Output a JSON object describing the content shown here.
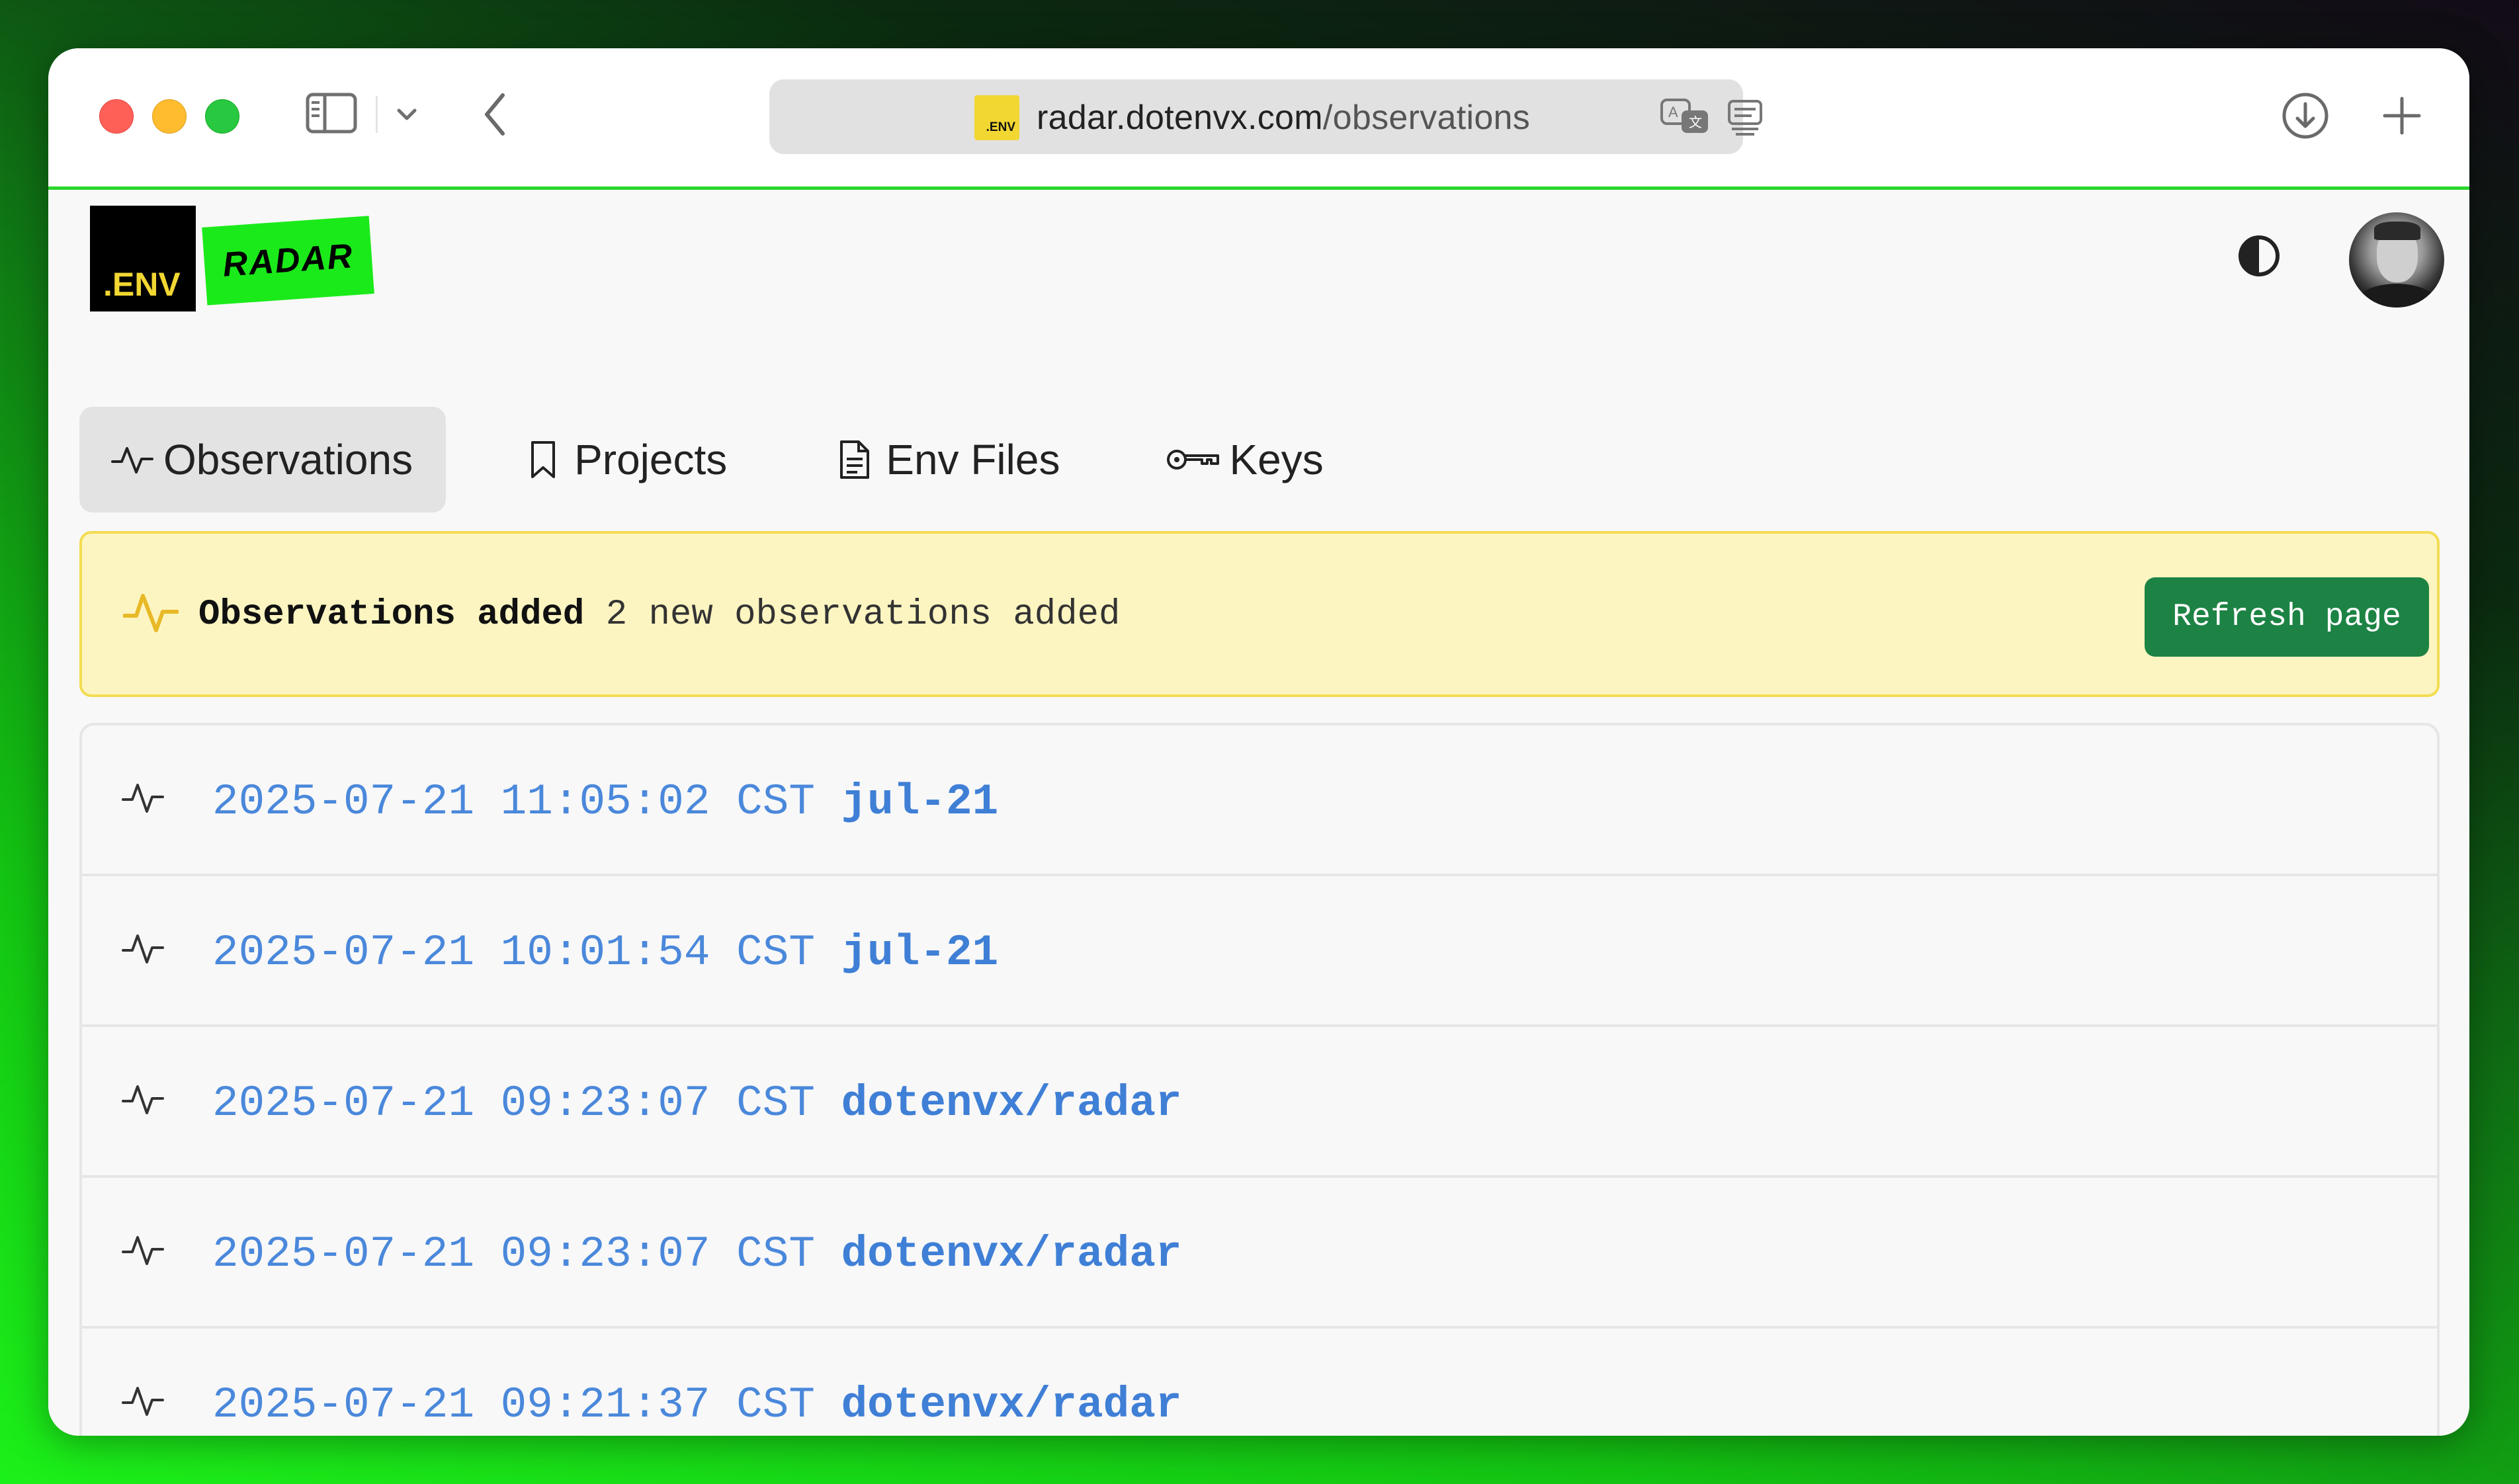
{
  "browser": {
    "url_domain": "radar.dotenvx.com",
    "url_path": "/observations",
    "favicon_text": ".ENV",
    "icons": {
      "sidebar": "sidebar-icon",
      "tab_overview": "chevron-down-icon",
      "back": "chevron-left-icon",
      "translate": "translate-icon",
      "reader": "reader-icon",
      "download": "download-icon",
      "new_tab": "plus-icon"
    }
  },
  "header": {
    "logo_env_text": ".ENV",
    "logo_radar_text": "RADAR",
    "theme_icon": "contrast-icon",
    "avatar": "avatar"
  },
  "tabs": [
    {
      "label": "Observations",
      "icon": "activity-icon",
      "active": true
    },
    {
      "label": "Projects",
      "icon": "bookmark-icon",
      "active": false
    },
    {
      "label": "Env Files",
      "icon": "document-icon",
      "active": false
    },
    {
      "label": "Keys",
      "icon": "key-icon",
      "active": false
    }
  ],
  "banner": {
    "title": "Observations added",
    "message": "2 new observations added",
    "button_label": "Refresh page",
    "icon": "activity-icon"
  },
  "observations": [
    {
      "timestamp": "2025-07-21 11:05:02 CST",
      "project": "jul-21"
    },
    {
      "timestamp": "2025-07-21 10:01:54 CST",
      "project": "jul-21"
    },
    {
      "timestamp": "2025-07-21 09:23:07 CST",
      "project": "dotenvx/radar"
    },
    {
      "timestamp": "2025-07-21 09:23:07 CST",
      "project": "dotenvx/radar"
    },
    {
      "timestamp": "2025-07-21 09:21:37 CST",
      "project": "dotenvx/radar"
    }
  ],
  "colors": {
    "accent_green": "#1bea1a",
    "env_yellow": "#f2d632",
    "link_blue": "#4a88db",
    "button_green": "#1c8344",
    "banner_bg": "#fdf5c1"
  }
}
